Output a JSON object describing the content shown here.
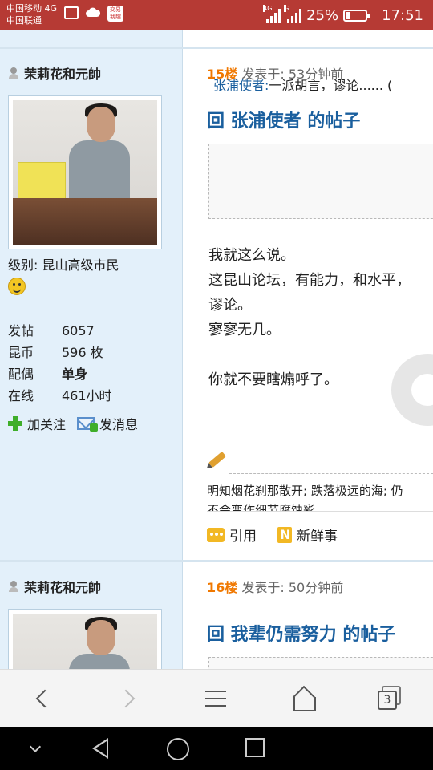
{
  "status_bar": {
    "carrier1": "中国移动 4G",
    "carrier2": "中国联通",
    "app_badge": "交易 我趣",
    "net1": "4G",
    "net2": "G",
    "battery": "25%",
    "time": "17:51"
  },
  "post1": {
    "username": "茉莉花和元帥",
    "level_label": "级别:",
    "level_value": "昆山高级市民",
    "stats": [
      {
        "key": "发帖",
        "value": "6057"
      },
      {
        "key": "昆币",
        "value": "596 枚"
      },
      {
        "key": "配偶",
        "value": "单身"
      },
      {
        "key": "在线",
        "value": "461小时"
      }
    ],
    "follow_label": "加关注",
    "message_label": "发消息",
    "floor": "15楼",
    "posted": "发表于: 53分钟前",
    "reply_title": "回 张浦使者 的帖子",
    "quote_author": "张浦使者:",
    "quote_text": "一派胡言，谬论...... (",
    "body_lines": [
      "我就这么说。",
      "这昆山论坛，有能力，和水平，",
      "谬论。",
      "寥寥无几。",
      "",
      "你就不要瞎煽呼了。"
    ],
    "signature_line1": "明知烟花刹那散开; 跌落极远的海; 仍",
    "signature_line2": "不会变作细节腐蚀彩",
    "quote_action": "引用",
    "news_action": "新鲜事"
  },
  "post2": {
    "username": "茉莉花和元帥",
    "floor": "16楼",
    "posted": "发表于: 50分钟前",
    "reply_title": "回 我辈仍需努力 的帖子"
  },
  "browser": {
    "tab_count": "3"
  }
}
